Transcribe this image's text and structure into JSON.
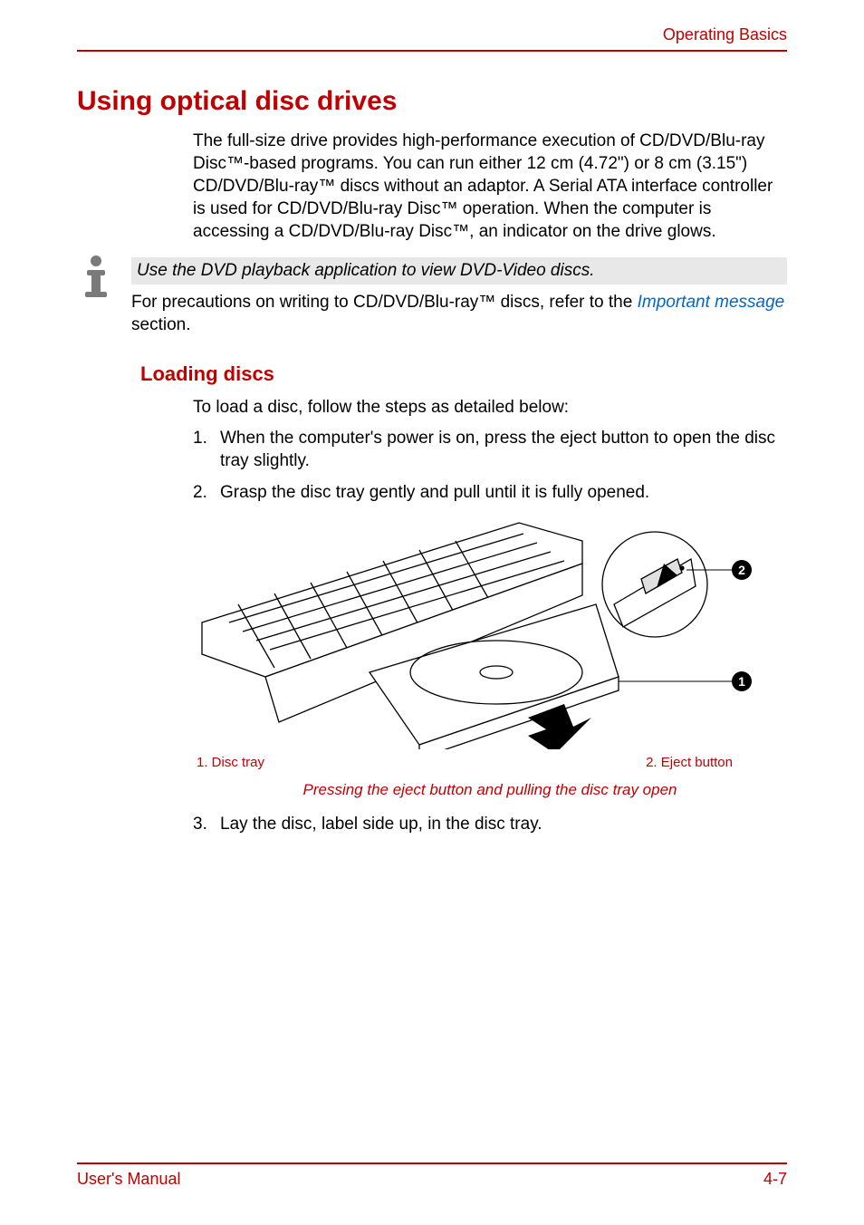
{
  "header": {
    "chapter": "Operating Basics"
  },
  "section": {
    "title": "Using optical disc drives",
    "intro": "The full-size drive provides high-performance execution of CD/DVD/Blu-ray Disc™-based programs. You can run either 12 cm (4.72\") or 8 cm (3.15\") CD/DVD/Blu-ray™ discs without an adaptor. A Serial ATA interface controller is used for CD/DVD/Blu-ray Disc™ operation. When the computer is accessing a CD/DVD/Blu-ray Disc™, an indicator on the drive glows."
  },
  "note": {
    "highlight": "Use the DVD playback application to view DVD-Video discs.",
    "followup_pre": "For precautions on writing to CD/DVD/Blu-ray™ discs, refer to the ",
    "followup_link": "Important message",
    "followup_post": " section."
  },
  "subsection": {
    "title": "Loading discs",
    "intro": "To load a disc, follow the steps as detailed below:",
    "steps": [
      {
        "num": "1.",
        "text": "When the computer's power is on, press the eject button to open the disc tray slightly."
      },
      {
        "num": "2.",
        "text": "Grasp the disc tray gently and pull until it is fully opened."
      },
      {
        "num": "3.",
        "text": "Lay the disc, label side up, in the disc tray."
      }
    ]
  },
  "figure": {
    "callouts": [
      {
        "num": "1",
        "label": "1. Disc tray"
      },
      {
        "num": "2",
        "label": "2. Eject button"
      }
    ],
    "caption": "Pressing the eject button and pulling the disc tray open"
  },
  "footer": {
    "left": "User's Manual",
    "right": "4-7"
  }
}
